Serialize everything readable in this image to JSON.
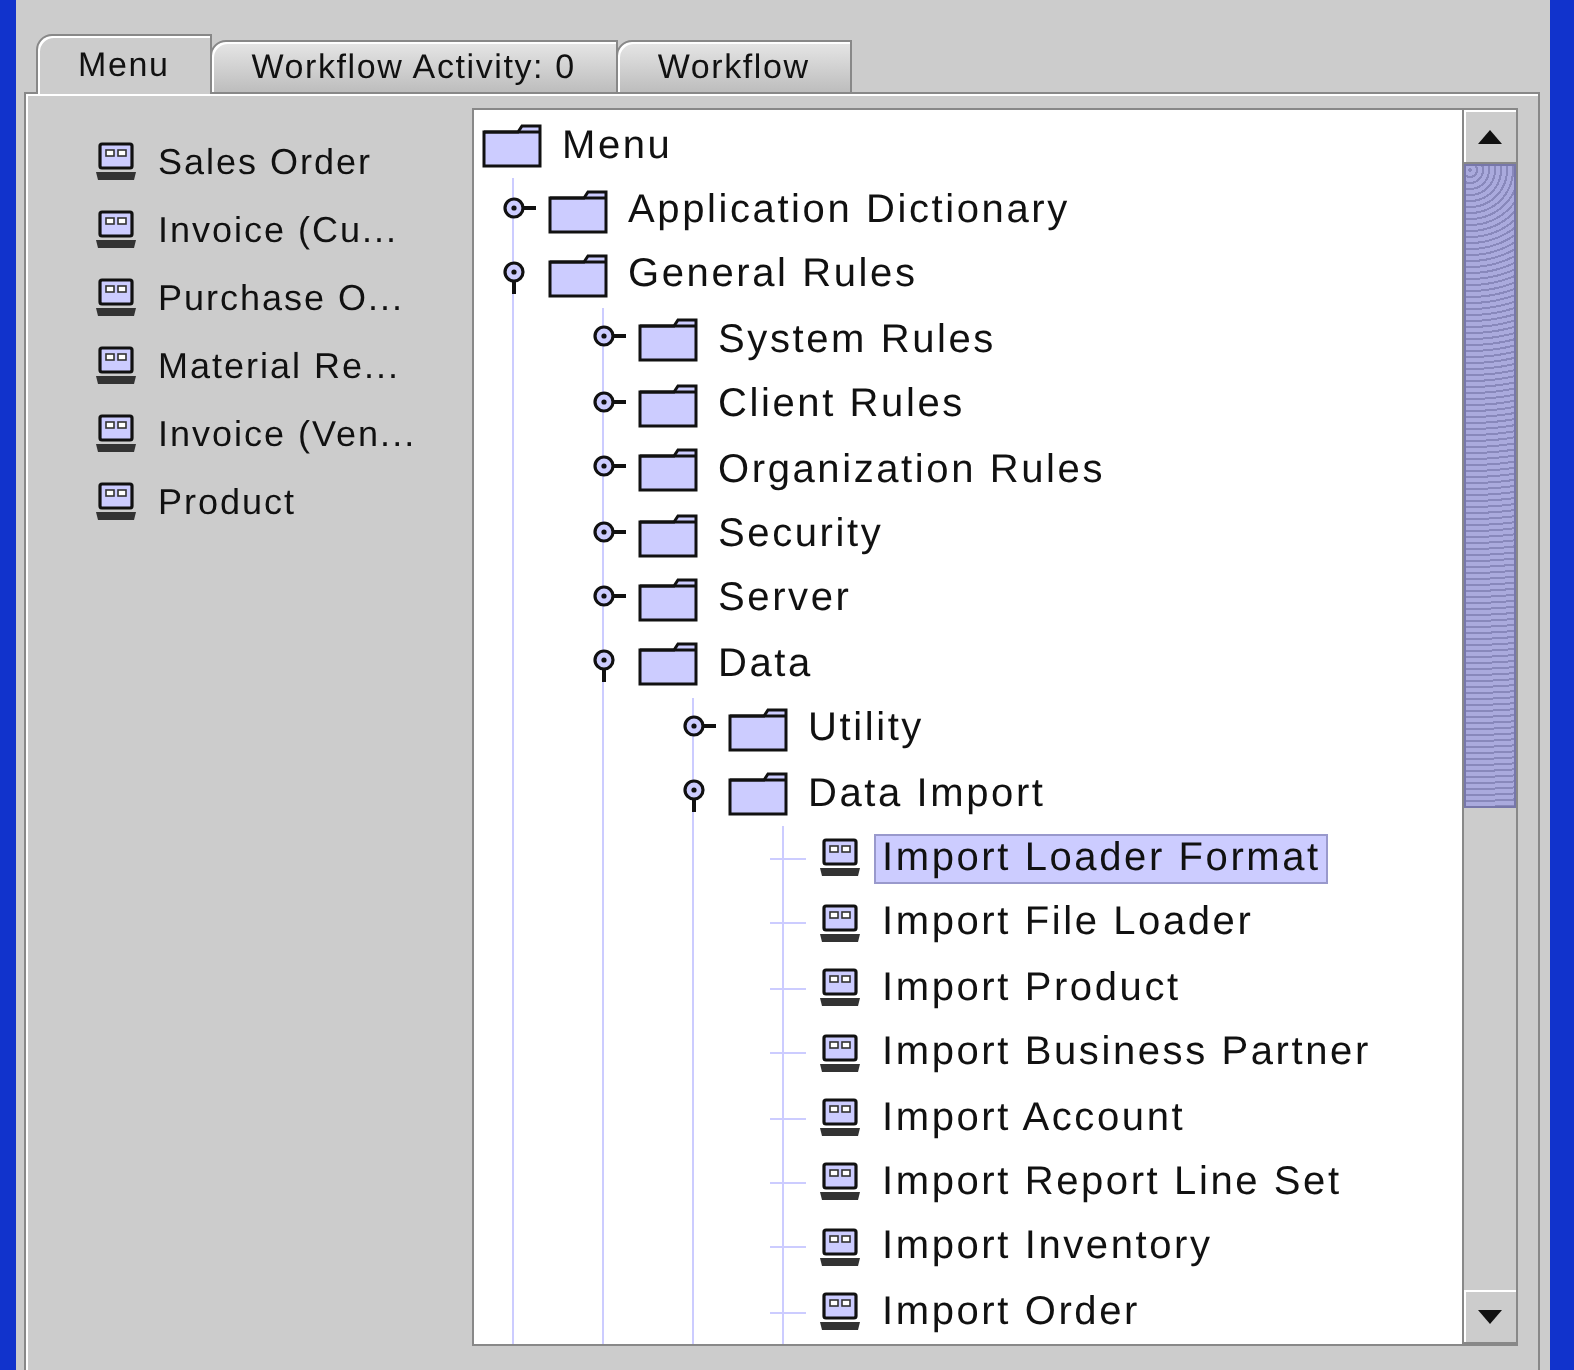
{
  "tabs": [
    {
      "label": "Menu",
      "selected": true
    },
    {
      "label": "Workflow Activity: 0",
      "selected": false
    },
    {
      "label": "Workflow",
      "selected": false
    }
  ],
  "shortcuts": [
    {
      "label": "Sales Order"
    },
    {
      "label": "Invoice (Cu..."
    },
    {
      "label": "Purchase O..."
    },
    {
      "label": "Material Re..."
    },
    {
      "label": "Invoice (Ven..."
    },
    {
      "label": "Product"
    }
  ],
  "tree": {
    "label": "Menu",
    "kind": "folder",
    "expanded": true,
    "selected": false,
    "children": [
      {
        "label": "Application Dictionary",
        "kind": "folder",
        "expanded": false,
        "selected": false
      },
      {
        "label": "General Rules",
        "kind": "folder",
        "expanded": true,
        "selected": false,
        "children": [
          {
            "label": "System Rules",
            "kind": "folder",
            "expanded": false,
            "selected": false
          },
          {
            "label": "Client Rules",
            "kind": "folder",
            "expanded": false,
            "selected": false
          },
          {
            "label": "Organization Rules",
            "kind": "folder",
            "expanded": false,
            "selected": false
          },
          {
            "label": "Security",
            "kind": "folder",
            "expanded": false,
            "selected": false
          },
          {
            "label": "Server",
            "kind": "folder",
            "expanded": false,
            "selected": false
          },
          {
            "label": "Data",
            "kind": "folder",
            "expanded": true,
            "selected": false,
            "children": [
              {
                "label": "Utility",
                "kind": "folder",
                "expanded": false,
                "selected": false
              },
              {
                "label": "Data Import",
                "kind": "folder",
                "expanded": true,
                "selected": false,
                "children": [
                  {
                    "label": "Import Loader Format",
                    "kind": "window",
                    "selected": true
                  },
                  {
                    "label": "Import File Loader",
                    "kind": "window",
                    "selected": false
                  },
                  {
                    "label": "Import Product",
                    "kind": "window",
                    "selected": false
                  },
                  {
                    "label": "Import Business Partner",
                    "kind": "window",
                    "selected": false
                  },
                  {
                    "label": "Import Account",
                    "kind": "window",
                    "selected": false
                  },
                  {
                    "label": "Import Report Line Set",
                    "kind": "window",
                    "selected": false
                  },
                  {
                    "label": "Import Inventory",
                    "kind": "window",
                    "selected": false
                  },
                  {
                    "label": "Import Order",
                    "kind": "window",
                    "selected": false
                  }
                ]
              }
            ]
          }
        ]
      }
    ]
  }
}
